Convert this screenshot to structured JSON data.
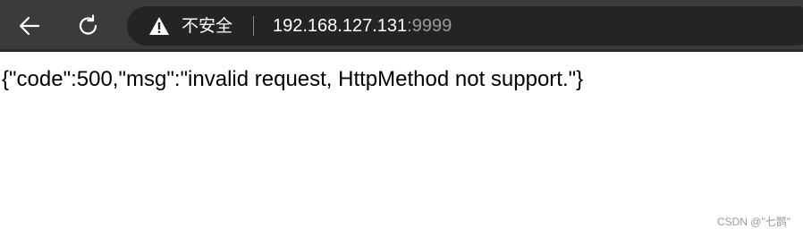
{
  "toolbar": {
    "back_icon": "back-arrow-icon",
    "reload_icon": "reload-icon"
  },
  "omnibox": {
    "security_icon": "warning-triangle-icon",
    "security_label": "不安全",
    "url_host": "192.168.127.131",
    "url_port": ":9999"
  },
  "page": {
    "body_text": "{\"code\":500,\"msg\":\"invalid request, HttpMethod not support.\"}"
  },
  "watermark": {
    "text": "CSDN @\"七鹊\""
  },
  "colors": {
    "toolbar_bg": "#3b3b3b",
    "omnibox_bg": "#242424",
    "page_bg": "#ffffff"
  }
}
